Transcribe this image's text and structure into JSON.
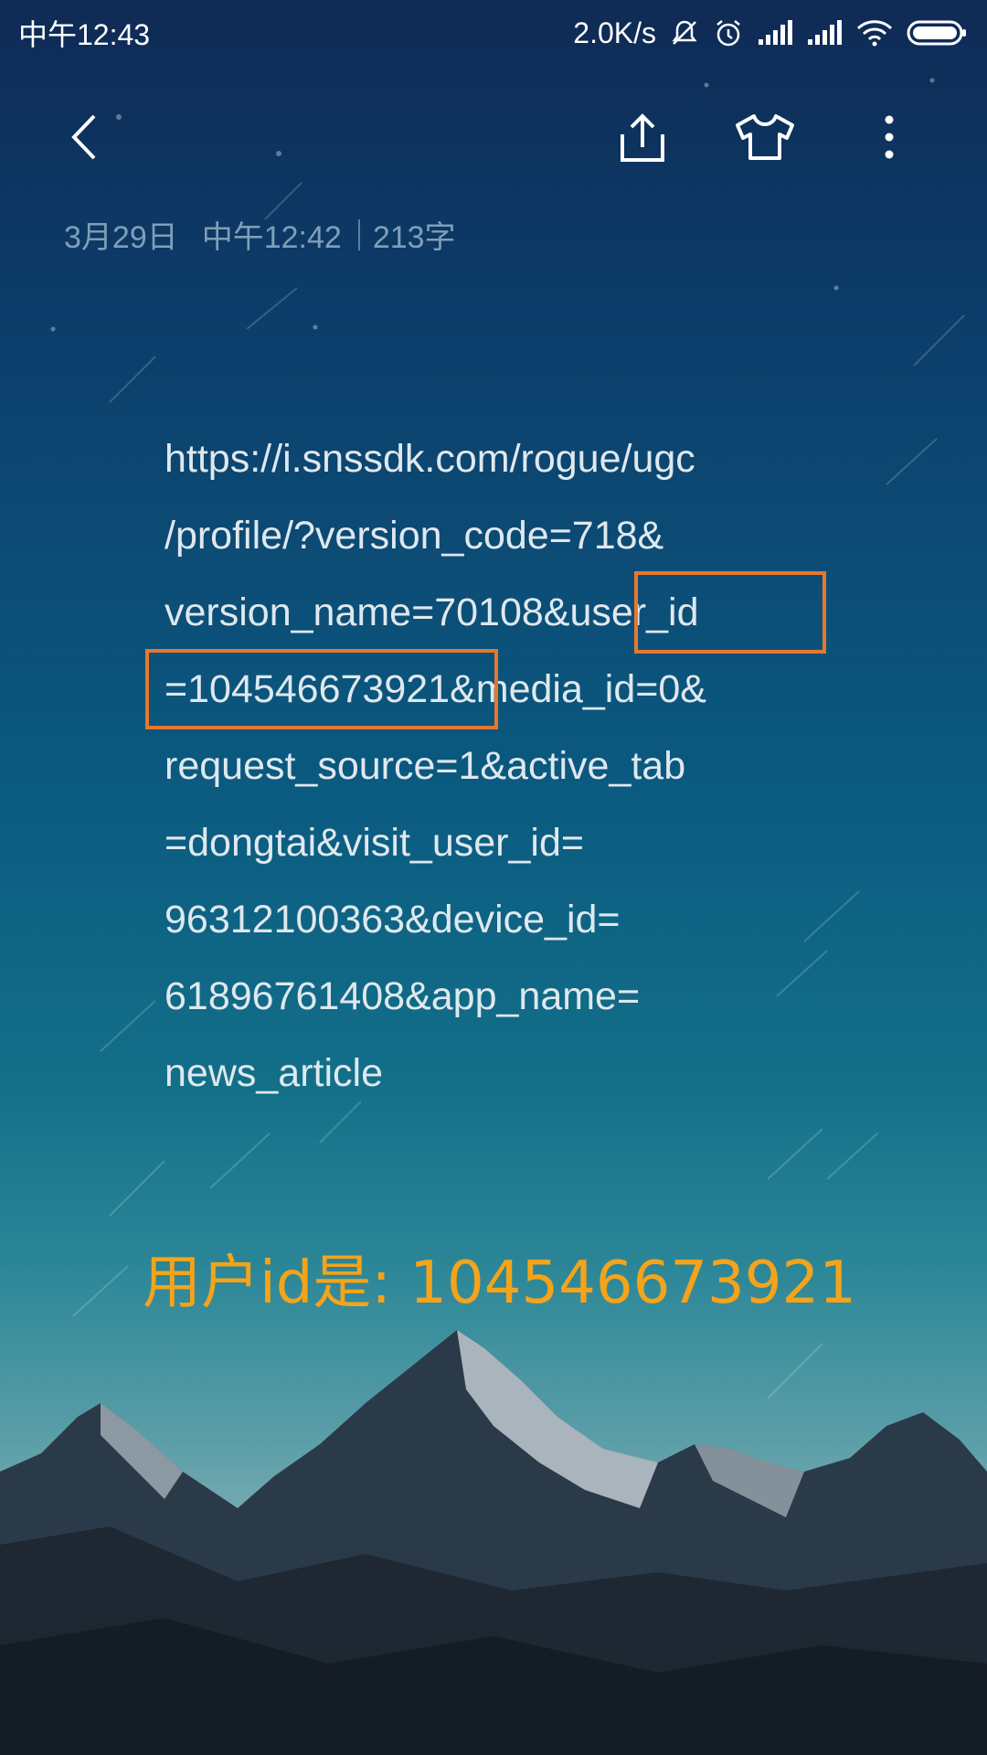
{
  "status_bar": {
    "time": "中午12:43",
    "net_speed": "2.0K/s",
    "icons": [
      "mute-icon",
      "alarm-icon",
      "signal-icon",
      "signal-icon",
      "wifi-icon",
      "battery-icon"
    ]
  },
  "toolbar": {
    "icons": [
      "back-icon",
      "share-icon",
      "theme-shirt-icon",
      "more-icon"
    ]
  },
  "note": {
    "date": "3月29日",
    "time": "中午12:42",
    "char_count": "213字",
    "lines": [
      "https://i.snssdk.com/rogue/ugc",
      "/profile/?version_code=718&",
      "version_name=70108&user_id",
      "=104546673921&media_id=0&",
      "request_source=1&active_tab",
      "=dongtai&visit_user_id=",
      "96312100363&device_id=",
      "61896761408&app_name=",
      "news_article"
    ]
  },
  "caption": "用户id是: 104546673921",
  "colors": {
    "highlight_box": "#e8772e",
    "caption": "#f5a31a"
  }
}
